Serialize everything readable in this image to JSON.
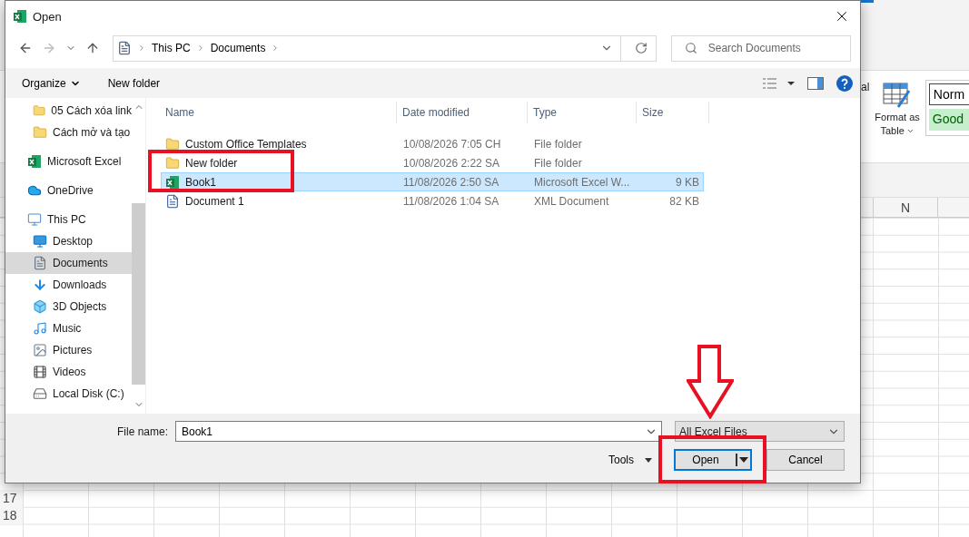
{
  "excel": {
    "ribbon": {
      "partial_label": "al",
      "format_as_table": [
        "Format as",
        "Table"
      ],
      "styles": [
        {
          "label": "Norm",
          "kind": "normal"
        },
        {
          "label": "Good",
          "kind": "good"
        }
      ]
    },
    "columns": [
      {
        "label": "N"
      }
    ],
    "row_numbers": [
      "17",
      "18"
    ]
  },
  "dialog": {
    "title": "Open",
    "address": {
      "crumbs": [
        "This PC",
        "Documents"
      ]
    },
    "search": {
      "placeholder": "Search Documents"
    },
    "toolbar": {
      "organize": "Organize",
      "new_folder": "New folder"
    },
    "sidebar": {
      "items": [
        {
          "children": [
            {
              "label": "05 Cách xóa link",
              "kind": "folder",
              "selected": false
            },
            {
              "label": "Cách mở và tạo",
              "kind": "folder",
              "selected": false
            }
          ]
        },
        {
          "label": "Microsoft Excel",
          "kind": "excel",
          "selected": false
        },
        {
          "label": "OneDrive",
          "kind": "onedrive",
          "selected": false
        },
        {
          "label": "This PC",
          "kind": "pc",
          "selected": false,
          "children": [
            {
              "label": "Desktop",
              "kind": "desktop",
              "selected": false
            },
            {
              "label": "Documents",
              "kind": "documents",
              "selected": true
            },
            {
              "label": "Downloads",
              "kind": "downloads",
              "selected": false
            },
            {
              "label": "3D Objects",
              "kind": "objects",
              "selected": false
            },
            {
              "label": "Music",
              "kind": "music",
              "selected": false
            },
            {
              "label": "Pictures",
              "kind": "pictures",
              "selected": false
            },
            {
              "label": "Videos",
              "kind": "videos",
              "selected": false
            },
            {
              "label": "Local Disk (C:)",
              "kind": "disk",
              "selected": false
            }
          ]
        }
      ]
    },
    "columns": [
      "Name",
      "Date modified",
      "Type",
      "Size"
    ],
    "files": [
      {
        "name": "Custom Office Templates",
        "date": "10/08/2026 7:05 CH",
        "type": "File folder",
        "kind": "folder",
        "selected": false
      },
      {
        "name": "New folder",
        "date": "10/08/2026 2:22 SA",
        "type": "File folder",
        "kind": "folder",
        "selected": false
      },
      {
        "name": "Book1",
        "date": "11/08/2026 2:50 SA",
        "type": "Microsoft Excel W...",
        "size": "9 KB",
        "kind": "excel",
        "selected": true
      },
      {
        "name": "Document 1",
        "date": "11/08/2026 1:04 SA",
        "type": "XML Document",
        "size": "82 KB",
        "kind": "xml",
        "selected": false
      }
    ],
    "file_name": {
      "label": "File name:",
      "value": "Book1"
    },
    "filter": {
      "value": "All Excel Files"
    },
    "buttons": {
      "tools": "Tools",
      "open": "Open",
      "cancel": "Cancel"
    }
  },
  "annotations": [
    {
      "kind": "box"
    },
    {
      "kind": "arrow"
    },
    {
      "kind": "box"
    }
  ]
}
